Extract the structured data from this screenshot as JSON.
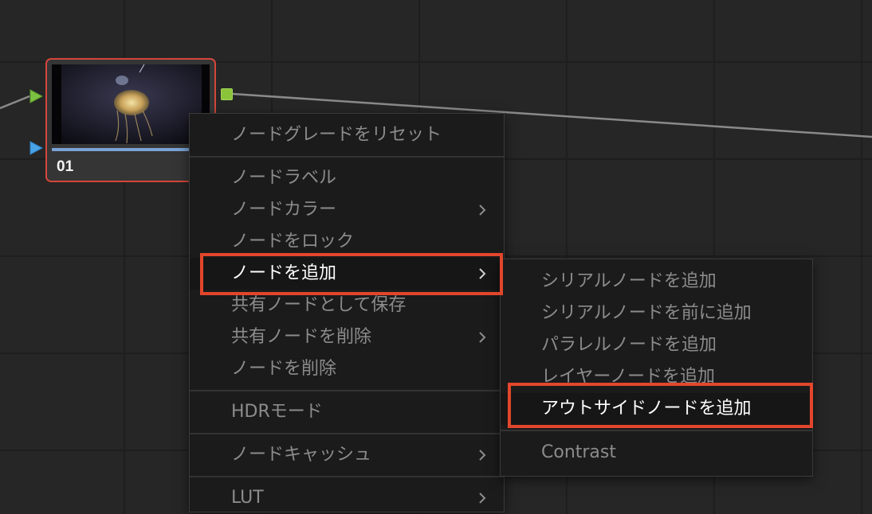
{
  "node": {
    "label": "01",
    "thumbnail_icon": "jellyfish-thumbnail",
    "input_rgb_color": "#7cc242",
    "input_alpha_color": "#4aa3e6",
    "output_color": "#8bc43b",
    "border_color": "#d4463a"
  },
  "context_menu": {
    "items": [
      {
        "label": "ノードグレードをリセット"
      },
      {
        "label": "ノードラベル"
      },
      {
        "label": "ノードカラー"
      },
      {
        "label": "ノードをロック"
      },
      {
        "label": "ノードを追加"
      },
      {
        "label": "共有ノードとして保存"
      },
      {
        "label": "共有ノードを削除"
      },
      {
        "label": "ノードを削除"
      },
      {
        "label": "HDRモード"
      },
      {
        "label": "ノードキャッシュ"
      },
      {
        "label": "LUT"
      }
    ],
    "submenu_icon": "chevron-right-icon"
  },
  "add_node_submenu": {
    "items": [
      {
        "label": "シリアルノードを追加"
      },
      {
        "label": "シリアルノードを前に追加"
      },
      {
        "label": "パラレルノードを追加"
      },
      {
        "label": "レイヤーノードを追加"
      },
      {
        "label": "アウトサイドノードを追加"
      },
      {
        "label": "Contrast"
      }
    ]
  },
  "highlight_color": "#e2462c"
}
